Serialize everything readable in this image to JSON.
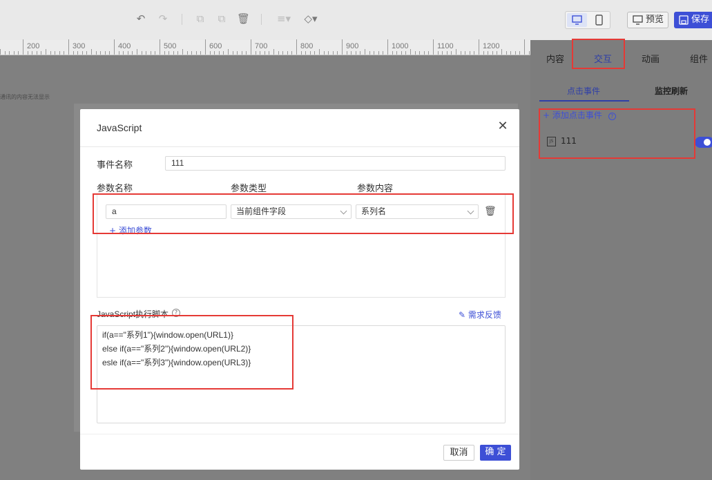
{
  "toolbar": {
    "icons": [
      "undo-icon",
      "redo-icon",
      "copy-icon",
      "paste-icon",
      "delete-icon",
      "align-icon",
      "layers-icon"
    ],
    "preview_label": "预览",
    "save_label": "保存",
    "accent_color": "#3d4fd6"
  },
  "ruler": {
    "labels": [
      "200",
      "300",
      "400",
      "500",
      "600",
      "700",
      "800",
      "900",
      "1000",
      "1100",
      "1200"
    ]
  },
  "canvas": {
    "note": "通讯的内容无法显示"
  },
  "right_panel": {
    "tabs": [
      "内容",
      "交互",
      "动画",
      "组件"
    ],
    "active_tab": "交互",
    "subtabs": [
      "点击事件",
      "监控刷新"
    ],
    "active_subtab": "点击事件",
    "add_event_label": "添加点击事件",
    "event": {
      "name": "111",
      "icon": "javascript-file-icon",
      "enabled": true
    }
  },
  "modal": {
    "title": "JavaScript",
    "event_name_label": "事件名称",
    "event_name_value": "111",
    "param_headers": {
      "name": "参数名称",
      "type": "参数类型",
      "content": "参数内容"
    },
    "params": [
      {
        "name": "a",
        "type": "当前组件字段",
        "content": "系列名"
      }
    ],
    "add_param_label": "添加参数",
    "script_label": "JavaScript执行脚本",
    "feedback_label": "需求反馈",
    "script_lines": [
      "if(a==\"系列1\"){window.open(URL1)}",
      "else if(a==\"系列2\"){window.open(URL2)}",
      "esle if(a==\"系列3\"){window.open(URL3)}"
    ],
    "cancel_label": "取消",
    "confirm_label": "确 定"
  },
  "highlight_color": "#e53935"
}
